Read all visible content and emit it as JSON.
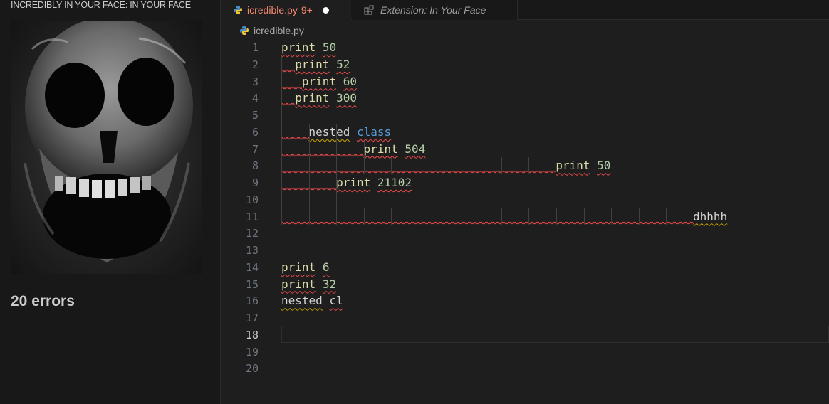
{
  "sidebar": {
    "title": "INCREDIBLY IN YOUR FACE: IN YOUR FACE",
    "error_count": "20 errors",
    "image_icon": "screaming-skull-image"
  },
  "tabs": [
    {
      "label": "icredible.py",
      "badge": "9+",
      "icon": "python-icon",
      "modified": true,
      "active": true
    },
    {
      "label": "Extension: In Your Face",
      "icon": "extension-icon",
      "active": false
    }
  ],
  "breadcrumb": {
    "file": "icredible.py",
    "icon": "python-icon"
  },
  "editor": {
    "current_line": 18,
    "lines": [
      {
        "n": "1",
        "text": "print 50"
      },
      {
        "n": "2",
        "text": "  print 52"
      },
      {
        "n": "3",
        "text": "   print 60"
      },
      {
        "n": "4",
        "text": "  print 300"
      },
      {
        "n": "5",
        "text": ""
      },
      {
        "n": "6",
        "text": "    nested class"
      },
      {
        "n": "7",
        "text": "            print 504"
      },
      {
        "n": "8",
        "text": "                                        print 50"
      },
      {
        "n": "9",
        "text": "        print 21102"
      },
      {
        "n": "10",
        "text": ""
      },
      {
        "n": "11",
        "text": "                                                            dhhhh"
      },
      {
        "n": "12",
        "text": ""
      },
      {
        "n": "13",
        "text": ""
      },
      {
        "n": "14",
        "text": "print 6"
      },
      {
        "n": "15",
        "text": "print 32"
      },
      {
        "n": "16",
        "text": "nested cl"
      },
      {
        "n": "17",
        "text": ""
      },
      {
        "n": "18",
        "text": ""
      },
      {
        "n": "19",
        "text": ""
      },
      {
        "n": "20",
        "text": ""
      }
    ]
  },
  "colors": {
    "error": "#f14c4c",
    "warning": "#cca700",
    "number": "#b5cea8",
    "function": "#dcdcaa",
    "keyword": "#569cd6"
  }
}
